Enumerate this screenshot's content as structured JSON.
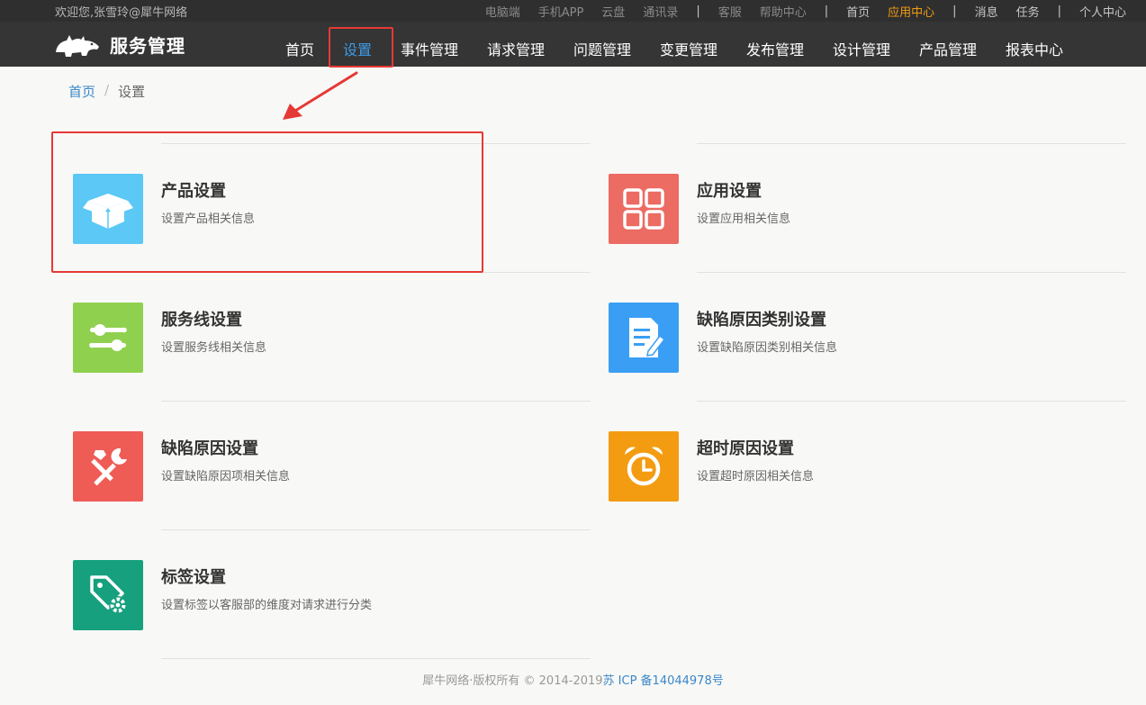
{
  "topbar": {
    "welcome": "欢迎您,张雪玲@犀牛网络",
    "links": [
      {
        "label": "电脑端",
        "style": "dim"
      },
      {
        "label": "手机APP",
        "style": "dim"
      },
      {
        "label": "云盘",
        "style": "dim"
      },
      {
        "label": "通讯录",
        "style": "dim"
      },
      {
        "label": "|",
        "style": "sep"
      },
      {
        "label": "客服",
        "style": "dim"
      },
      {
        "label": "帮助中心",
        "style": "dim"
      },
      {
        "label": "|",
        "style": "sep"
      },
      {
        "label": "首页",
        "style": "light"
      },
      {
        "label": "应用中心",
        "style": "active"
      },
      {
        "label": "|",
        "style": "sep"
      },
      {
        "label": "消息",
        "style": "light"
      },
      {
        "label": "任务",
        "style": "light"
      },
      {
        "label": "|",
        "style": "sep"
      },
      {
        "label": "个人中心",
        "style": "light"
      }
    ]
  },
  "navbar": {
    "logo_text": "服务管理",
    "items": [
      {
        "label": "首页"
      },
      {
        "label": "设置",
        "active": true
      },
      {
        "label": "事件管理"
      },
      {
        "label": "请求管理"
      },
      {
        "label": "问题管理"
      },
      {
        "label": "变更管理"
      },
      {
        "label": "发布管理"
      },
      {
        "label": "设计管理"
      },
      {
        "label": "产品管理"
      },
      {
        "label": "报表中心"
      }
    ]
  },
  "breadcrumb": {
    "home": "首页",
    "separator": "/",
    "current": "设置"
  },
  "cards": [
    {
      "title": "产品设置",
      "desc": "设置产品相关信息",
      "icon": "box-icon",
      "color": "#5bc8f5"
    },
    {
      "title": "应用设置",
      "desc": "设置应用相关信息",
      "icon": "grid-icon",
      "color": "#ec6b63"
    },
    {
      "title": "服务线设置",
      "desc": "设置服务线相关信息",
      "icon": "sliders-icon",
      "color": "#8fd14f"
    },
    {
      "title": "缺陷原因类别设置",
      "desc": "设置缺陷原因类别相关信息",
      "icon": "document-edit-icon",
      "color": "#3a9ff4"
    },
    {
      "title": "缺陷原因设置",
      "desc": "设置缺陷原因项相关信息",
      "icon": "tools-icon",
      "color": "#ef5b55"
    },
    {
      "title": "超时原因设置",
      "desc": "设置超时原因相关信息",
      "icon": "alarm-clock-icon",
      "color": "#f39c12"
    },
    {
      "title": "标签设置",
      "desc": "设置标签以客服部的维度对请求进行分类",
      "icon": "tag-settings-icon",
      "color": "#16a07e"
    }
  ],
  "footer": {
    "copyright": "犀牛网络·版权所有 © 2014-2019",
    "icp": "苏 ICP 备14044978号"
  },
  "colors": {
    "topbar_bg": "#2f2f2f",
    "navbar_bg": "#353535",
    "nav_active": "#3d9be8",
    "top_active": "#f39c12",
    "link": "#3b87c8",
    "highlight": "#e53935"
  }
}
